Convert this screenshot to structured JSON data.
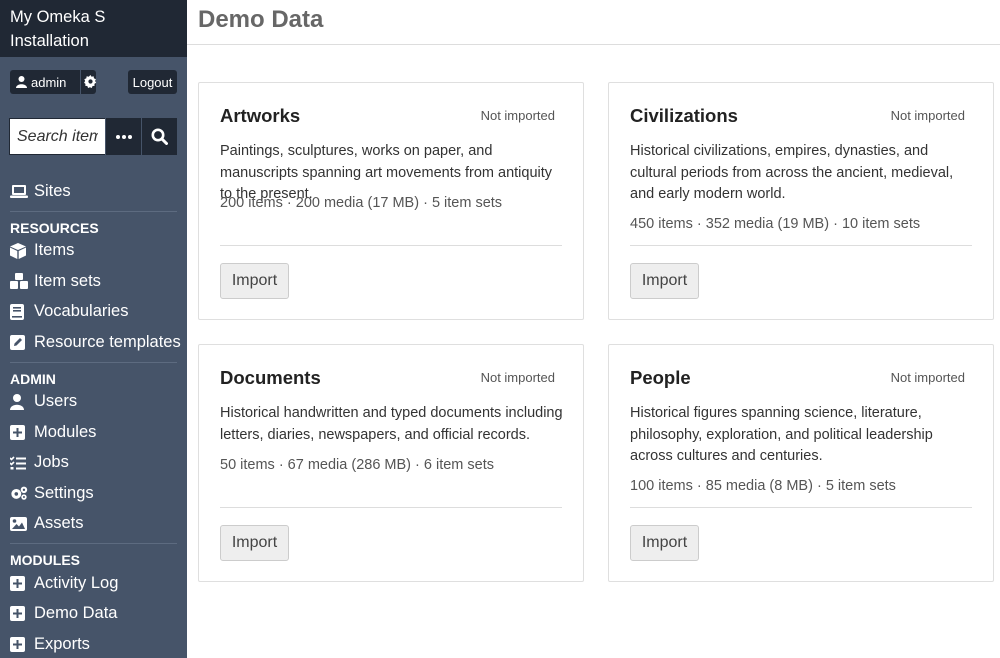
{
  "sidebar": {
    "site_title_line1": "My Omeka S",
    "site_title_line2": "Installation",
    "user_name": "admin",
    "logout_label": "Logout",
    "search_placeholder": "Search items",
    "sites": "Sites",
    "resources_heading": "RESOURCES",
    "items": "Items",
    "item_sets": "Item sets",
    "vocabularies": "Vocabularies",
    "resource_templates": "Resource templates",
    "admin_heading": "ADMIN",
    "users": "Users",
    "modules": "Modules",
    "jobs": "Jobs",
    "settings": "Settings",
    "assets": "Assets",
    "modules_heading": "MODULES",
    "activity_log": "Activity Log",
    "demo_data": "Demo Data",
    "exports": "Exports"
  },
  "header": {
    "title": "Demo Data"
  },
  "cards": [
    {
      "title": "Artworks",
      "status": "Not imported",
      "description": "Paintings, sculptures, works on paper, and manuscripts spanning art movements from antiquity to the present.",
      "stats": "200 items · 200 media (17 MB) · 5 item sets",
      "button": "Import"
    },
    {
      "title": "Civilizations",
      "status": "Not imported",
      "description": "Historical civilizations, empires, dynasties, and cultural periods from across the ancient, medieval, and early modern world.",
      "stats": "450 items · 352 media (19 MB) · 10 item sets",
      "button": "Import"
    },
    {
      "title": "Documents",
      "status": "Not imported",
      "description": "Historical handwritten and typed documents including letters, diaries, newspapers, and official records.",
      "stats": "50 items · 67 media (286 MB) · 6 item sets",
      "button": "Import"
    },
    {
      "title": "People",
      "status": "Not imported",
      "description": "Historical figures spanning science, literature, philosophy, exploration, and political leadership across cultures and centuries.",
      "stats": "100 items · 85 media (8 MB) · 5 item sets",
      "button": "Import"
    }
  ]
}
